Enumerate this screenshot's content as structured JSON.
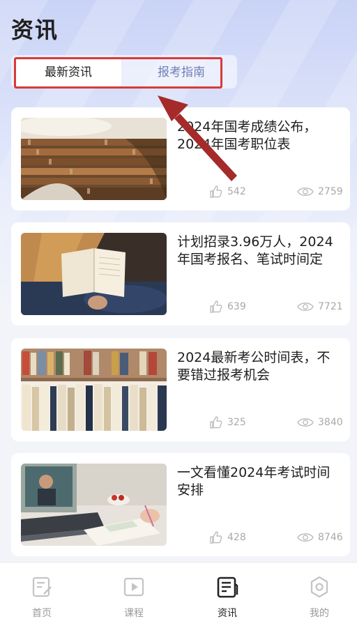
{
  "header": {
    "title": "资讯"
  },
  "tabs": [
    {
      "label": "最新资讯",
      "active": true
    },
    {
      "label": "报考指南",
      "active": false
    }
  ],
  "articles": [
    {
      "title": "2024年国考成绩公布，2024年国考职位表",
      "likes": "542",
      "views": "2759",
      "image": "library-bookshelves"
    },
    {
      "title": "计划招录3.96万人，2024年国考报名、笔试时间定",
      "likes": "639",
      "views": "7721",
      "image": "open-book-reading"
    },
    {
      "title": "2024最新考公时间表，不要错过报考机会",
      "likes": "325",
      "views": "3840",
      "image": "bookshelf-books"
    },
    {
      "title": "一文看懂2024年考试时间安排",
      "likes": "428",
      "views": "8746",
      "image": "laptop-study-desk"
    }
  ],
  "bottom_nav": [
    {
      "label": "首页",
      "icon": "home-icon",
      "active": false
    },
    {
      "label": "课程",
      "icon": "course-play-icon",
      "active": false
    },
    {
      "label": "资讯",
      "icon": "news-icon",
      "active": true
    },
    {
      "label": "我的",
      "icon": "settings-gear-icon",
      "active": false
    }
  ],
  "colors": {
    "highlight": "#d83a3a",
    "arrow": "#a52a2a",
    "tab_inactive": "#6e7fb6",
    "nav_active": "#1e1e1e",
    "nav_inactive": "#9a9a9a"
  }
}
